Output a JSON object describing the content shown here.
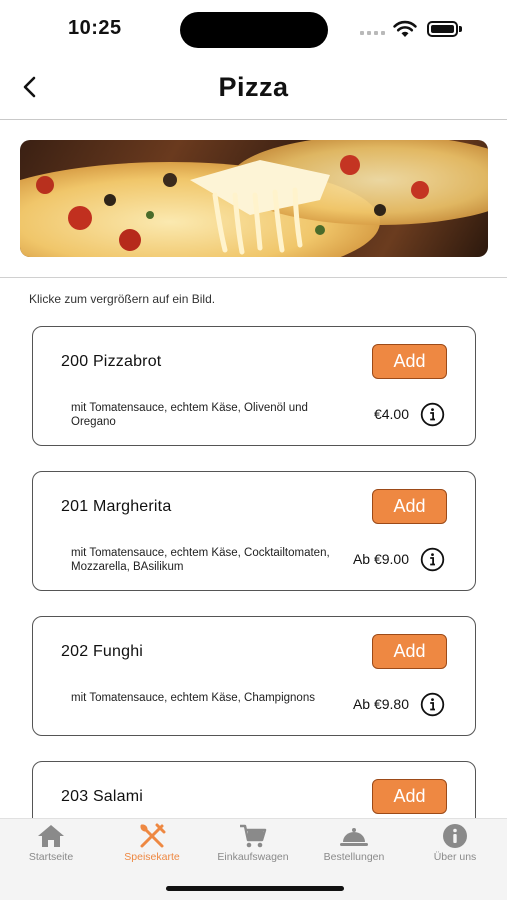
{
  "status_bar": {
    "time": "10:25"
  },
  "header": {
    "title": "Pizza"
  },
  "hint": "Klicke zum vergrößern auf ein Bild.",
  "items": [
    {
      "name": "200 Pizzabrot",
      "description": "mit Tomatensauce, echtem Käse, Olivenöl und Oregano",
      "price": "€4.00",
      "add_label": "Add"
    },
    {
      "name": "201 Margherita",
      "description": "mit Tomatensauce, echtem Käse, Cocktailtomaten, Mozzarella, BAsilikum",
      "price": "Ab €9.00",
      "add_label": "Add"
    },
    {
      "name": "202 Funghi",
      "description": "mit Tomatensauce, echtem Käse, Champignons",
      "price": "Ab €9.80",
      "add_label": "Add"
    },
    {
      "name": "203 Salami",
      "description": "",
      "price": "",
      "add_label": "Add"
    }
  ],
  "tabs": [
    {
      "label": "Startseite",
      "icon": "home-icon",
      "active": false
    },
    {
      "label": "Speisekarte",
      "icon": "fork-knife-icon",
      "active": true
    },
    {
      "label": "Einkaufswagen",
      "icon": "cart-icon",
      "active": false
    },
    {
      "label": "Bestellungen",
      "icon": "cloche-icon",
      "active": false
    },
    {
      "label": "Über uns",
      "icon": "info-circle-icon",
      "active": false
    }
  ],
  "colors": {
    "accent": "#ee8842",
    "tab_inactive": "#8a8a8a",
    "card_border": "#555555"
  }
}
